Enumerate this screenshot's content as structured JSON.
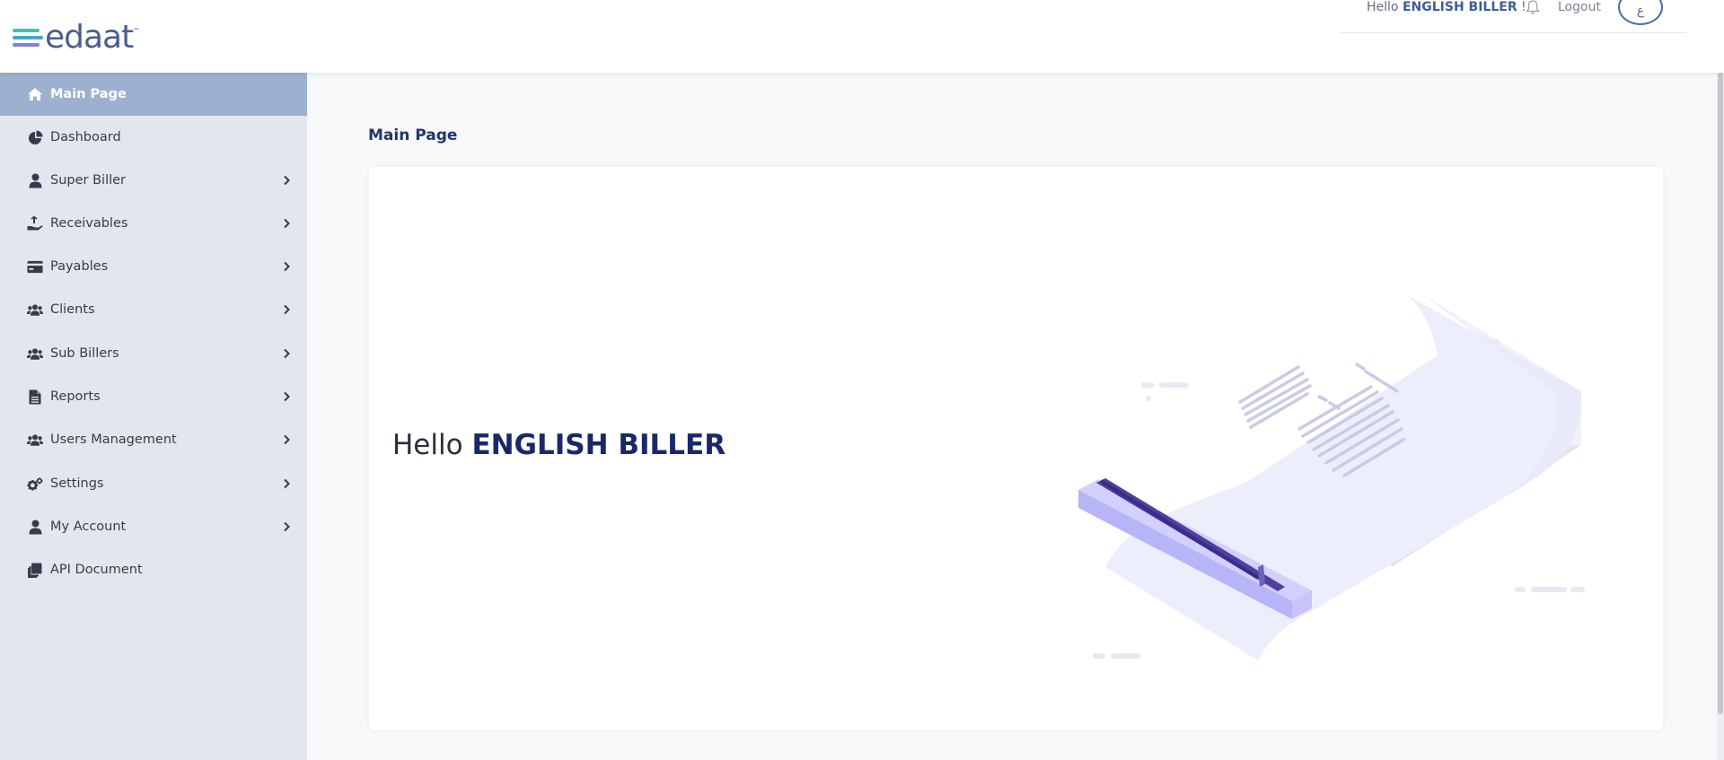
{
  "header": {
    "logo_text": "edaat",
    "logo_tm": "™",
    "greeting_prefix": "Hello",
    "greeting_name": "ENGLISH BILLER",
    "greeting_suffix": "!",
    "logout_label": "Logout",
    "language_button_label": "ع",
    "bell_icon": "bell-icon"
  },
  "sidebar": {
    "items": [
      {
        "label": "Main Page",
        "icon": "home-icon",
        "active": true,
        "has_submenu": false
      },
      {
        "label": "Dashboard",
        "icon": "pie-chart-icon",
        "active": false,
        "has_submenu": false
      },
      {
        "label": "Super Biller",
        "icon": "user-icon",
        "active": false,
        "has_submenu": true
      },
      {
        "label": "Receivables",
        "icon": "hand-holding-money-icon",
        "active": false,
        "has_submenu": true
      },
      {
        "label": "Payables",
        "icon": "credit-card-icon",
        "active": false,
        "has_submenu": true
      },
      {
        "label": "Clients",
        "icon": "users-icon",
        "active": false,
        "has_submenu": true
      },
      {
        "label": "Sub Billers",
        "icon": "users-icon",
        "active": false,
        "has_submenu": true
      },
      {
        "label": "Reports",
        "icon": "file-icon",
        "active": false,
        "has_submenu": true
      },
      {
        "label": "Users Management",
        "icon": "users-icon",
        "active": false,
        "has_submenu": true
      },
      {
        "label": "Settings",
        "icon": "gears-icon",
        "active": false,
        "has_submenu": true
      },
      {
        "label": "My Account",
        "icon": "user-icon",
        "active": false,
        "has_submenu": true
      },
      {
        "label": "API Document",
        "icon": "copy-icon",
        "active": false,
        "has_submenu": false
      }
    ]
  },
  "main": {
    "page_title": "Main Page",
    "hello_prefix": "Hello",
    "hello_name": "ENGLISH BILLER"
  },
  "colors": {
    "sidebar_bg": "#e3e6ef",
    "sidebar_active": "#9eb0cf",
    "brand_navy": "#18286a",
    "brand_blue": "#4b6aa6"
  }
}
